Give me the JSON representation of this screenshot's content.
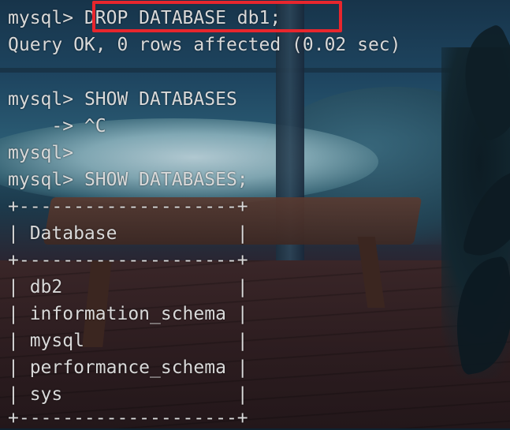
{
  "terminal": {
    "lines": [
      {
        "prompt": "mysql> ",
        "command": "DROP DATABASE db1;"
      },
      {
        "text": "Query OK, 0 rows affected (0.02 sec)"
      },
      {
        "text": ""
      },
      {
        "prompt": "mysql> ",
        "command": "SHOW DATABASES"
      },
      {
        "text": "    -> ^C"
      },
      {
        "prompt": "mysql> ",
        "command": ""
      },
      {
        "prompt": "mysql> ",
        "command": "SHOW DATABASES;"
      }
    ],
    "table": {
      "border_top": "+--------------------+",
      "header": "| Database           |",
      "border_mid": "+--------------------+",
      "rows": [
        "| db2                |",
        "| information_schema |",
        "| mysql              |",
        "| performance_schema |",
        "| sys                |"
      ],
      "border_bottom": "+--------------------+"
    }
  },
  "colors": {
    "text": "#d9d9d9",
    "highlight": "#e8262d"
  }
}
